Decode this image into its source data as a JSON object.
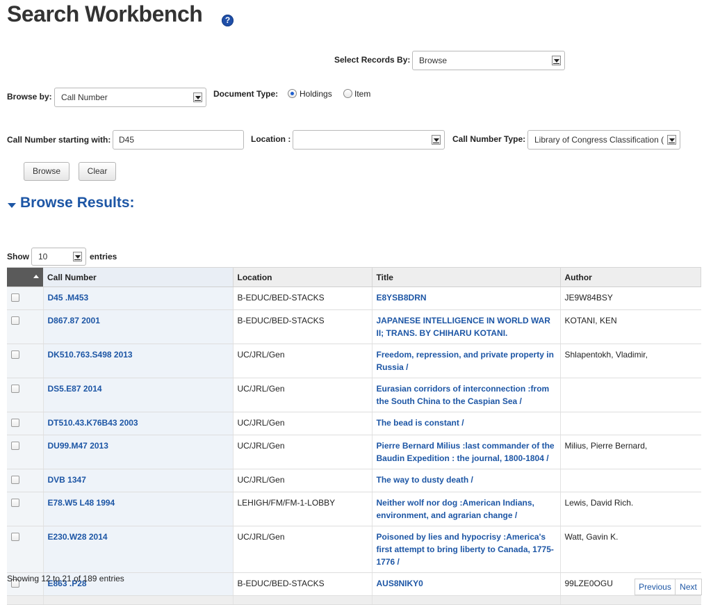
{
  "header": {
    "title": "Search Workbench",
    "help_glyph": "?"
  },
  "select_records": {
    "label": "Select Records By:",
    "value": "Browse"
  },
  "browse_by": {
    "label": "Browse by:",
    "value": "Call Number"
  },
  "document_type": {
    "label": "Document Type:",
    "options": [
      {
        "label": "Holdings",
        "selected": true
      },
      {
        "label": "Item",
        "selected": false
      }
    ]
  },
  "call_number_start": {
    "label": "Call Number starting with:",
    "value": "D45"
  },
  "location": {
    "label": "Location :",
    "value": ""
  },
  "call_number_type": {
    "label": "Call Number Type:",
    "value": "Library of Congress Classification ("
  },
  "buttons": {
    "browse": "Browse",
    "clear": "Clear"
  },
  "results": {
    "title": "Browse Results:",
    "show_label": "Show",
    "page_size": "10",
    "entries_label": "entries",
    "columns": [
      "Call Number",
      "Location",
      "Title",
      "Author"
    ],
    "rows": [
      {
        "call_number": "D45 .M453",
        "location": "B-EDUC/BED-STACKS",
        "title": "E8YSB8DRN",
        "author": "JE9W84BSY"
      },
      {
        "call_number": "D867.87 2001",
        "location": "B-EDUC/BED-STACKS",
        "title": "JAPANESE INTELLIGENCE IN WORLD WAR II; TRANS. BY CHIHARU KOTANI.",
        "author": "KOTANI, KEN"
      },
      {
        "call_number": "DK510.763.S498 2013",
        "location": "UC/JRL/Gen",
        "title": "Freedom, repression, and private property in Russia /",
        "author": "Shlapentokh, Vladimir,"
      },
      {
        "call_number": "DS5.E87 2014",
        "location": "UC/JRL/Gen",
        "title": "Eurasian corridors of interconnection :from the South China to the Caspian Sea /",
        "author": ""
      },
      {
        "call_number": "DT510.43.K76B43 2003",
        "location": "UC/JRL/Gen",
        "title": "The bead is constant /",
        "author": ""
      },
      {
        "call_number": "DU99.M47 2013",
        "location": "UC/JRL/Gen",
        "title": "Pierre Bernard Milius :last commander of the Baudin Expedition : the journal, 1800-1804 /",
        "author": "Milius, Pierre Bernard,"
      },
      {
        "call_number": "DVB 1347",
        "location": "UC/JRL/Gen",
        "title": "The way to dusty death /",
        "author": ""
      },
      {
        "call_number": "E78.W5 L48 1994",
        "location": "LEHIGH/FM/FM-1-LOBBY",
        "title": "Neither wolf nor dog :American Indians, environment, and agrarian change /",
        "author": "Lewis, David Rich."
      },
      {
        "call_number": "E230.W28 2014",
        "location": "UC/JRL/Gen",
        "title": "Poisoned by lies and hypocrisy :America's first attempt to bring liberty to Canada, 1775-1776 /",
        "author": "Watt, Gavin K."
      },
      {
        "call_number": "E863 .P28",
        "location": "B-EDUC/BED-STACKS",
        "title": "AUS8NIKY0",
        "author": "99LZE0OGU"
      }
    ],
    "info": "Showing 12 to 21 of 189 entries",
    "pagination": {
      "previous": "Previous",
      "next": "Next"
    }
  }
}
